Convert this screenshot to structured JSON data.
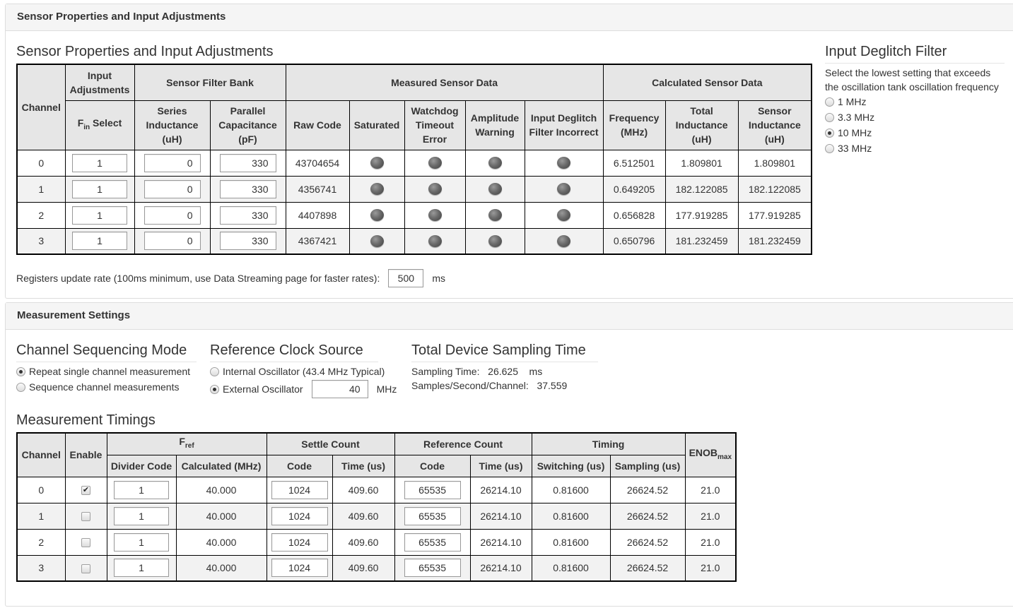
{
  "sensor_panel": {
    "heading": "Sensor Properties and Input Adjustments",
    "title": "Sensor Properties and Input Adjustments",
    "headers": {
      "channel": "Channel",
      "input_adjustments": "Input Adjustments",
      "sensor_filter_bank": "Sensor Filter Bank",
      "measured_sensor_data": "Measured Sensor Data",
      "calculated_sensor_data": "Calculated Sensor Data",
      "fin_select_main": "F",
      "fin_select_sub": "in",
      "fin_select_rest": " Select",
      "series_inductance": "Series Inductance (uH)",
      "parallel_capacitance": "Parallel Capacitance (pF)",
      "raw_code": "Raw Code",
      "saturated": "Saturated",
      "watchdog": "Watchdog Timeout Error",
      "amplitude": "Amplitude Warning",
      "deglitch_incorrect": "Input Deglitch Filter Incorrect",
      "frequency": "Frequency (MHz)",
      "total_inductance": "Total Inductance (uH)",
      "sensor_inductance": "Sensor Inductance (uH)"
    },
    "rows": [
      {
        "channel": "0",
        "fin": "1",
        "series": "0",
        "parallel": "330",
        "raw": "43704654",
        "freq": "6.512501",
        "total": "1.809801",
        "sensor": "1.809801"
      },
      {
        "channel": "1",
        "fin": "1",
        "series": "0",
        "parallel": "330",
        "raw": "4356741",
        "freq": "0.649205",
        "total": "182.122085",
        "sensor": "182.122085"
      },
      {
        "channel": "2",
        "fin": "1",
        "series": "0",
        "parallel": "330",
        "raw": "4407898",
        "freq": "0.656828",
        "total": "177.919285",
        "sensor": "177.919285"
      },
      {
        "channel": "3",
        "fin": "1",
        "series": "0",
        "parallel": "330",
        "raw": "4367421",
        "freq": "0.650796",
        "total": "181.232459",
        "sensor": "181.232459"
      }
    ],
    "update_rate_label": "Registers update rate (100ms minimum, use Data Streaming page for faster rates):",
    "update_rate_value": "500",
    "update_rate_unit": "ms"
  },
  "deglitch": {
    "title": "Input Deglitch Filter",
    "description_line1": "Select the lowest setting that exceeds",
    "description_line2": "the oscillation tank oscillation frequency",
    "options": [
      "1 MHz",
      "3.3 MHz",
      "10 MHz",
      "33 MHz"
    ],
    "selected": "10 MHz"
  },
  "measurement_panel": {
    "heading": "Measurement Settings",
    "sequencing": {
      "title": "Channel Sequencing Mode",
      "options": [
        "Repeat single channel measurement",
        "Sequence channel measurements"
      ],
      "selected": "Repeat single channel measurement"
    },
    "ref_clock": {
      "title": "Reference Clock Source",
      "internal_label": "Internal Oscillator (43.4 MHz Typical)",
      "external_label": "External Oscillator",
      "external_value": "40",
      "external_unit": "MHz",
      "selected": "External Oscillator"
    },
    "sampling": {
      "title": "Total Device Sampling Time",
      "sampling_time_label": "Sampling Time:",
      "sampling_time_value": "26.625",
      "sampling_time_unit": "ms",
      "samples_label": "Samples/Second/Channel:",
      "samples_value": "37.559"
    },
    "timings": {
      "title": "Measurement Timings",
      "headers": {
        "channel": "Channel",
        "enable": "Enable",
        "fref_main": "F",
        "fref_sub": "ref",
        "settle_count": "Settle Count",
        "reference_count": "Reference Count",
        "timing": "Timing",
        "enob_main": "ENOB",
        "enob_sub": "max",
        "divider_code": "Divider Code",
        "calculated": "Calculated (MHz)",
        "code": "Code",
        "time_us": "Time (us)",
        "switching": "Switching (us)",
        "sampling": "Sampling (us)"
      },
      "rows": [
        {
          "channel": "0",
          "enabled": true,
          "divider": "1",
          "calc": "40.000",
          "settle_code": "1024",
          "settle_time": "409.60",
          "ref_code": "65535",
          "ref_time": "26214.10",
          "switching": "0.81600",
          "sampling": "26624.52",
          "enob": "21.0"
        },
        {
          "channel": "1",
          "enabled": false,
          "divider": "1",
          "calc": "40.000",
          "settle_code": "1024",
          "settle_time": "409.60",
          "ref_code": "65535",
          "ref_time": "26214.10",
          "switching": "0.81600",
          "sampling": "26624.52",
          "enob": "21.0"
        },
        {
          "channel": "2",
          "enabled": false,
          "divider": "1",
          "calc": "40.000",
          "settle_code": "1024",
          "settle_time": "409.60",
          "ref_code": "65535",
          "ref_time": "26214.10",
          "switching": "0.81600",
          "sampling": "26624.52",
          "enob": "21.0"
        },
        {
          "channel": "3",
          "enabled": false,
          "divider": "1",
          "calc": "40.000",
          "settle_code": "1024",
          "settle_time": "409.60",
          "ref_code": "65535",
          "ref_time": "26214.10",
          "switching": "0.81600",
          "sampling": "26624.52",
          "enob": "21.0"
        }
      ]
    }
  },
  "colors": {
    "panel_heading_bg": "#f5f5f5",
    "table_header_bg": "#e6e6e6",
    "table_border": "#000000",
    "row_stripe": "#f2f2f2",
    "led_off": "#5a5a5a"
  },
  "icons": {
    "status_led": "status-led-off-icon",
    "checkmark": "checkmark-icon"
  }
}
